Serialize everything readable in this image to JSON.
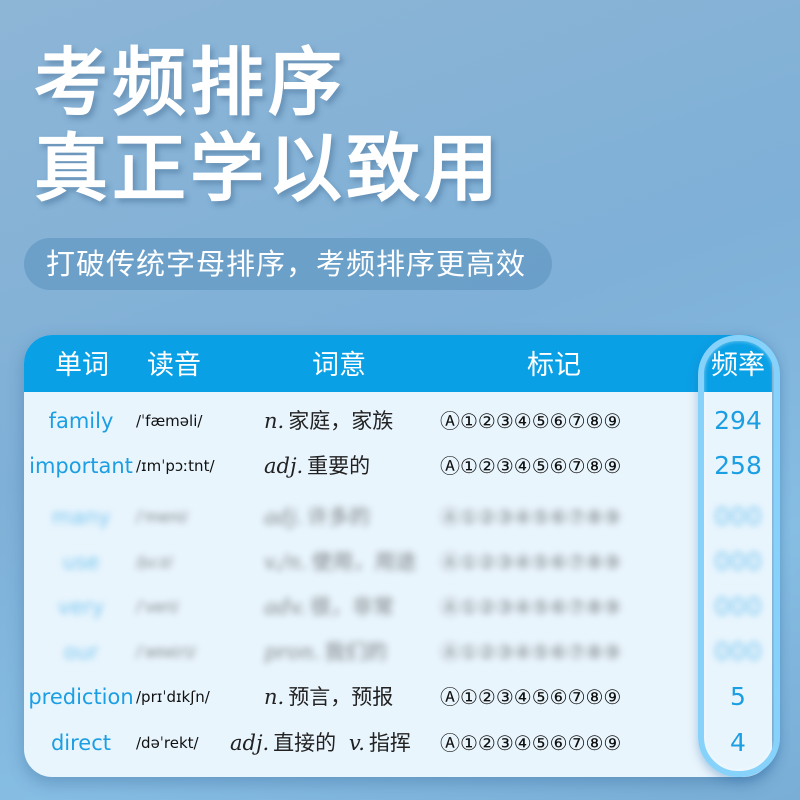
{
  "headline": {
    "line1": "考频排序",
    "line2": "真正学以致用"
  },
  "subtitle": "打破传统字母排序，考频排序更高效",
  "table": {
    "headers": {
      "word": "单词",
      "phonetic": "读音",
      "meaning": "词意",
      "marks": "标记",
      "frequency": "频率"
    },
    "marks_symbols": "Ⓐ①②③④⑤⑥⑦⑧⑨",
    "rows": [
      {
        "word": "family",
        "phonetic": "/ˈfæməli/",
        "pos": "n.",
        "meaning": "家庭，家族",
        "frequency": "294"
      },
      {
        "word": "important",
        "phonetic": "/ɪmˈpɔːtnt/",
        "pos": "adj.",
        "meaning": "重要的",
        "frequency": "258"
      },
      {
        "word": "many",
        "phonetic": "/ˈmeni/",
        "pos": "adj.",
        "meaning": "许多的",
        "frequency": "",
        "blurred": true
      },
      {
        "word": "use",
        "phonetic": "/juːz/",
        "pos": "v./n.",
        "meaning": "使用，用途",
        "frequency": "",
        "blurred": true
      },
      {
        "word": "very",
        "phonetic": "/ˈveri/",
        "pos": "adv.",
        "meaning": "很，非常",
        "frequency": "",
        "blurred": true
      },
      {
        "word": "our",
        "phonetic": "/ˈaʊə(r)/",
        "pos": "pron.",
        "meaning": "我们的",
        "frequency": "",
        "blurred": true
      },
      {
        "word": "prediction",
        "phonetic": "/prɪˈdɪkʃn/",
        "pos": "n.",
        "meaning": "预言，预报",
        "frequency": "5"
      },
      {
        "word": "direct",
        "phonetic": "/dəˈrekt/",
        "pos": "adj.",
        "meaning": "直接的",
        "pos2": "v.",
        "meaning2": "指挥",
        "frequency": "4"
      }
    ]
  },
  "colors": {
    "header_blue": "#0aa0e6",
    "word_blue": "#1c9ee3",
    "highlight_border": "#86d2fa",
    "table_bg": "#e9f5fd"
  }
}
